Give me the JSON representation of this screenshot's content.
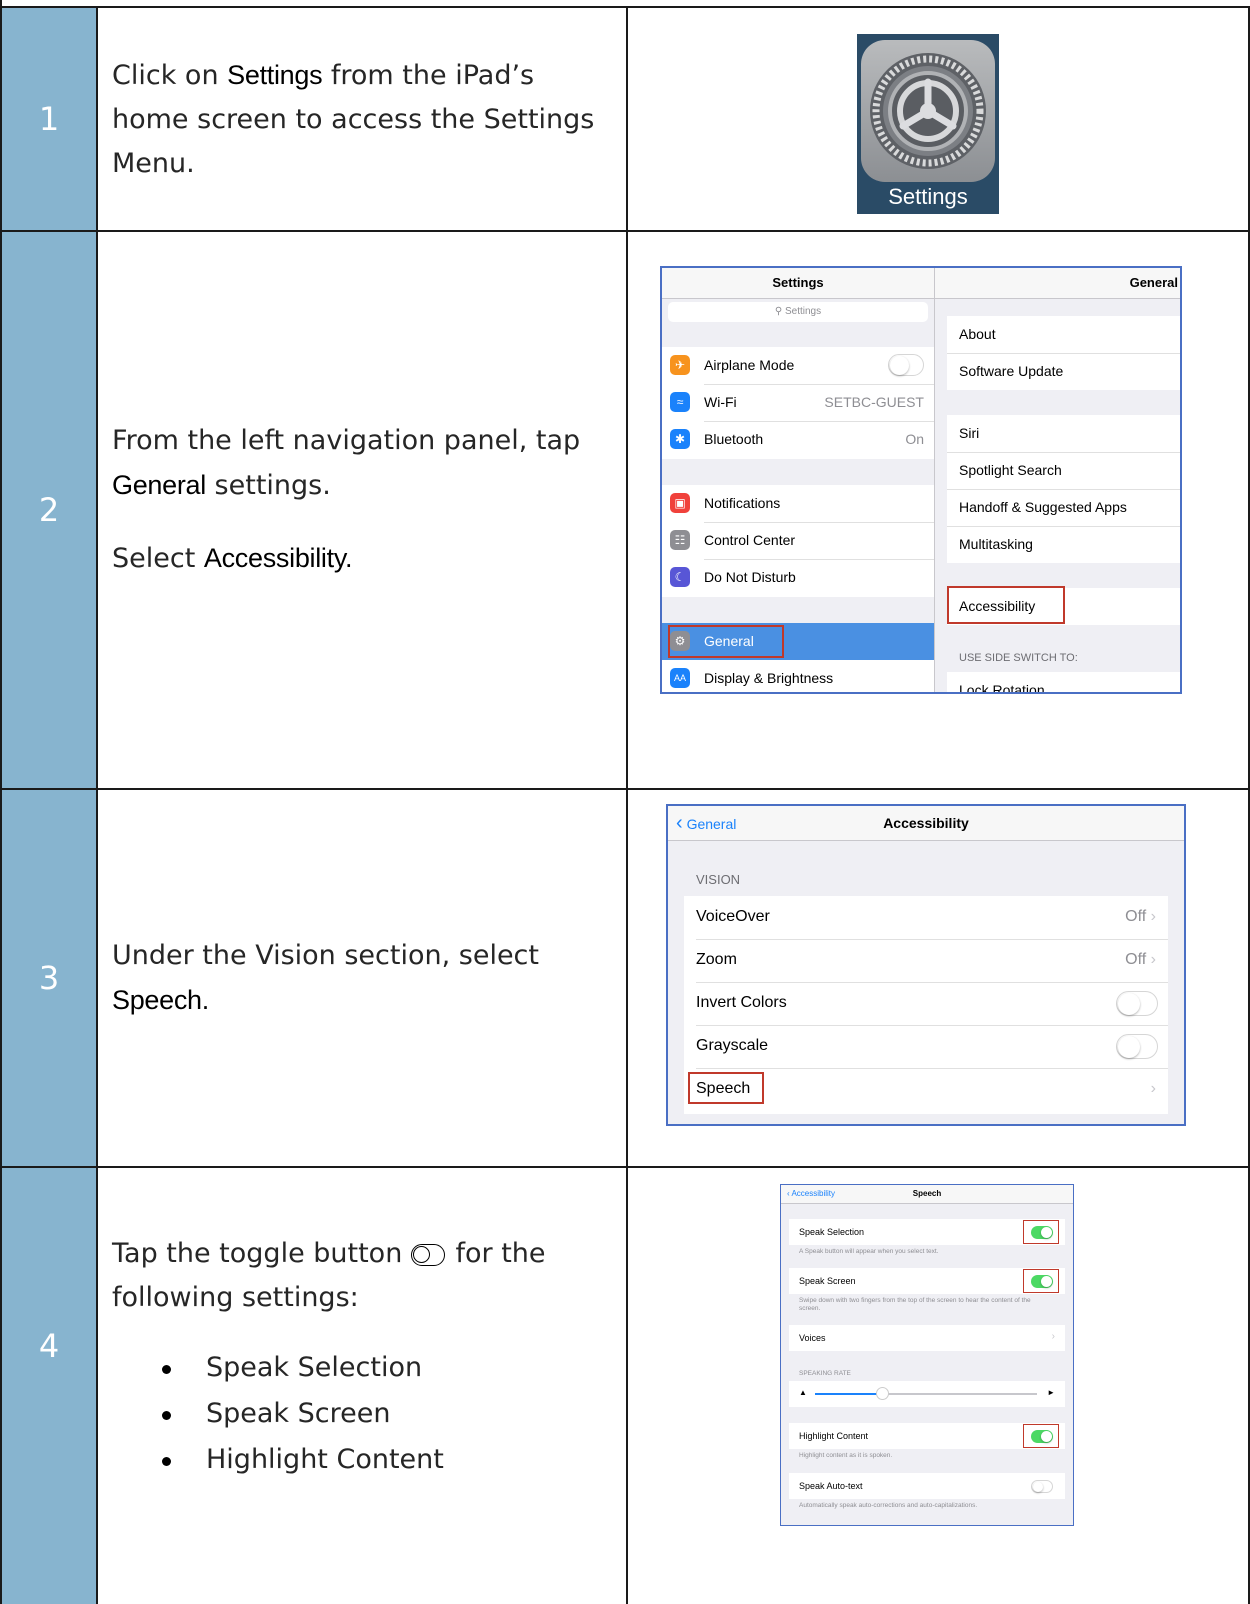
{
  "steps": [
    {
      "number": "1",
      "text_before": "Click on ",
      "bold1": "Settings",
      "text_after": " from the iPad’s home screen to access the Settings Menu.",
      "icon_label": "Settings"
    },
    {
      "number": "2",
      "line1_before": "From the left navigation panel, tap ",
      "line1_bold": "General",
      "line1_after": " settings.",
      "line2_before": "Select ",
      "line2_bold": "Accessibility."
    },
    {
      "number": "3",
      "text_before": "Under the Vision section, select ",
      "bold": "Speech."
    },
    {
      "number": "4",
      "text_before": "Tap the toggle button ",
      "text_after": " for the following settings:",
      "bullets": [
        "Speak Selection",
        "Speak Screen",
        "Highlight Content"
      ]
    }
  ],
  "shot2": {
    "left_title": "Settings",
    "right_title": "General",
    "search_placeholder": "Settings",
    "left_items": [
      {
        "label": "Airplane Mode",
        "value": "",
        "icon": "airplane-icon",
        "color": "#f7931e"
      },
      {
        "label": "Wi-Fi",
        "value": "SETBC-GUEST",
        "icon": "wifi-icon",
        "color": "#1a82fb"
      },
      {
        "label": "Bluetooth",
        "value": "On",
        "icon": "bluetooth-icon",
        "color": "#1a82fb"
      },
      {
        "label": "Notifications",
        "value": "",
        "icon": "notifications-icon",
        "color": "#f0413b"
      },
      {
        "label": "Control Center",
        "value": "",
        "icon": "control-center-icon",
        "color": "#8e8e93"
      },
      {
        "label": "Do Not Disturb",
        "value": "",
        "icon": "moon-icon",
        "color": "#5856d6"
      },
      {
        "label": "General",
        "value": "",
        "icon": "gear-icon",
        "color": "#8e8e93"
      },
      {
        "label": "Display & Brightness",
        "value": "",
        "icon": "display-icon",
        "color": "#1a82fb"
      }
    ],
    "right_items": [
      "About",
      "Software Update",
      "Siri",
      "Spotlight Search",
      "Handoff & Suggested Apps",
      "Multitasking",
      "Accessibility"
    ],
    "section_label": "USE SIDE SWITCH TO:",
    "cut_item": "Lock Rotation"
  },
  "shot3": {
    "back": "General",
    "title": "Accessibility",
    "section": "VISION",
    "rows": [
      {
        "label": "VoiceOver",
        "value": "Off"
      },
      {
        "label": "Zoom",
        "value": "Off"
      },
      {
        "label": "Invert Colors",
        "value": ""
      },
      {
        "label": "Grayscale",
        "value": ""
      },
      {
        "label": "Speech",
        "value": ""
      }
    ]
  },
  "shot4": {
    "back": "Accessibility",
    "title": "Speech",
    "speak_selection": "Speak Selection",
    "speak_selection_note": "A Speak button will appear when you select text.",
    "speak_screen": "Speak Screen",
    "speak_screen_note": "Swipe down with two fingers from the top of the screen to hear the content of the screen.",
    "voices": "Voices",
    "rate_label": "SPEAKING RATE",
    "rate_value": 0.3,
    "highlight": "Highlight Content",
    "highlight_note": "Highlight content as it is spoken.",
    "auto_text": "Speak Auto-text",
    "auto_text_note": "Automatically speak auto-corrections and auto-capitalizations."
  }
}
